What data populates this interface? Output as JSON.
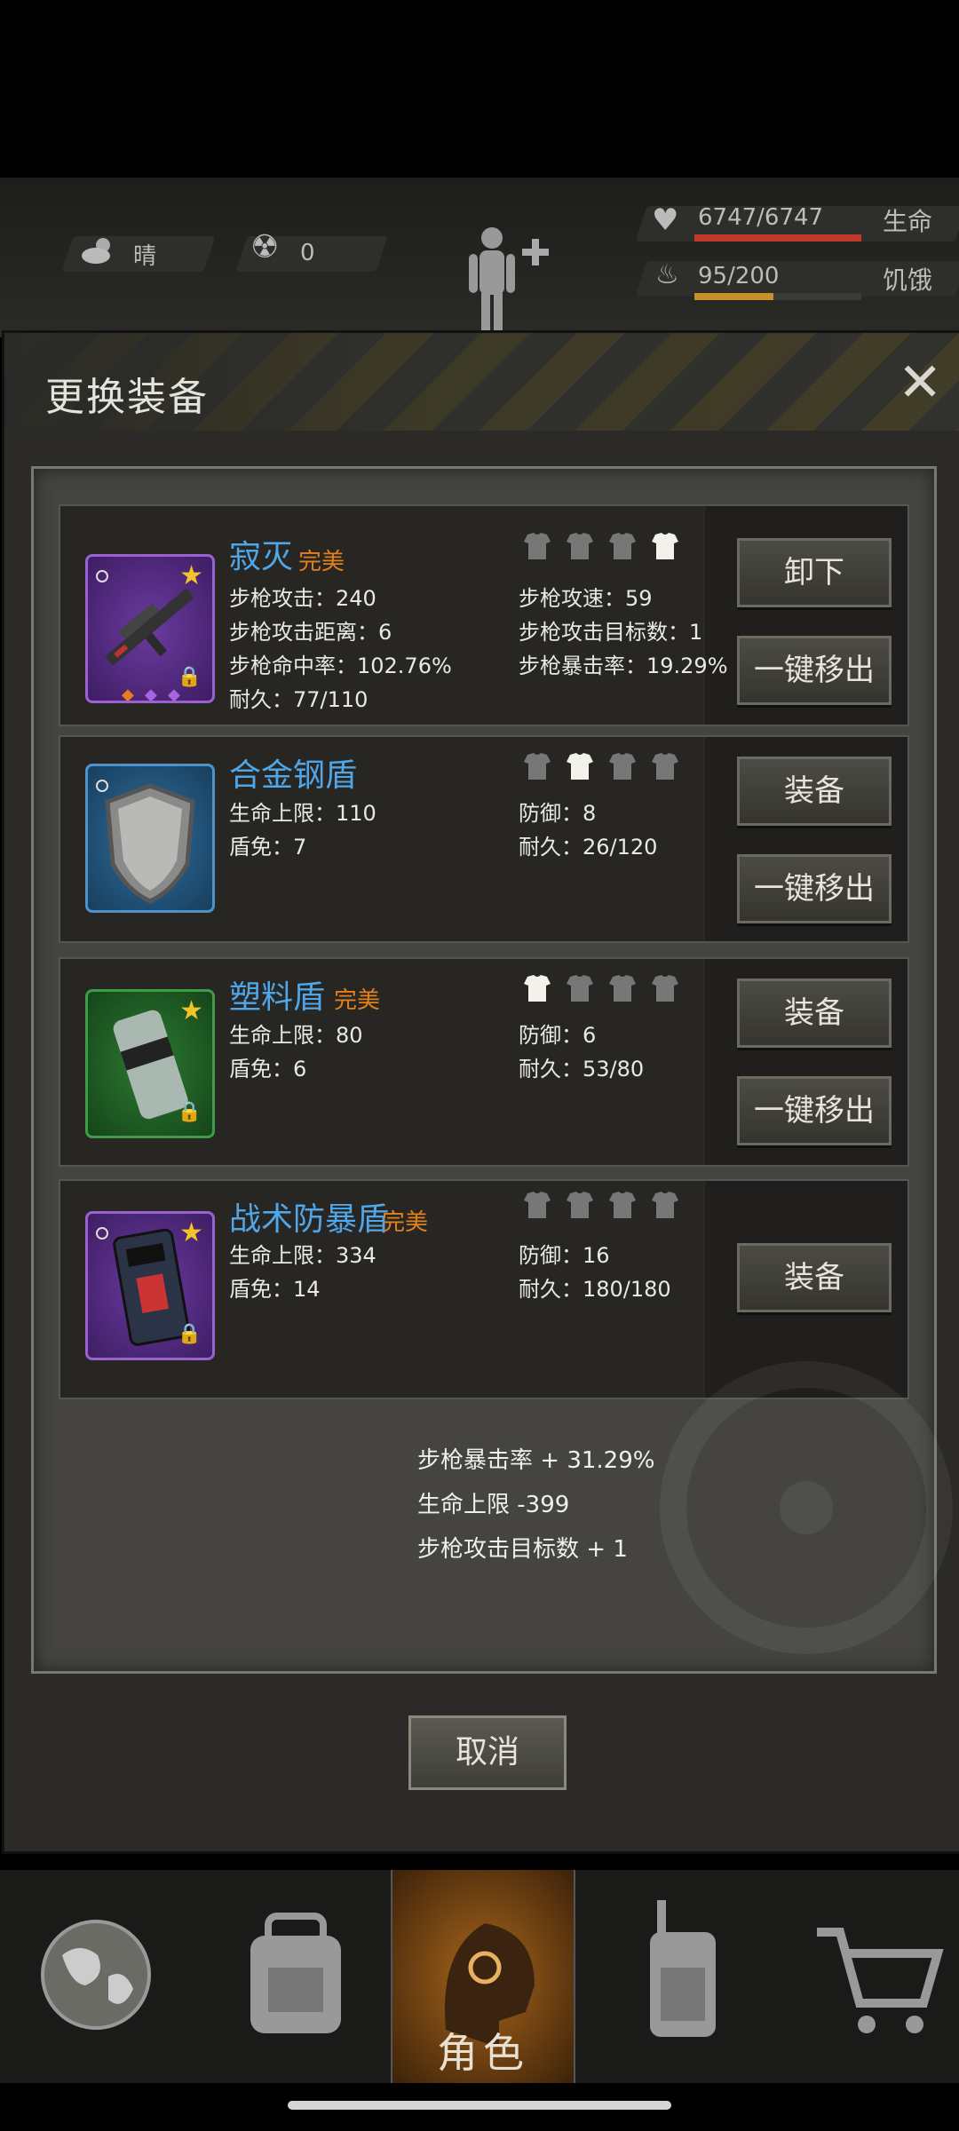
{
  "hud": {
    "weather": "晴",
    "radiation": "0",
    "life_value": "6747/6747",
    "life_label": "生命",
    "life_pct": 1.0,
    "hunger_value": "95/200",
    "hunger_label": "饥饿",
    "hunger_pct": 0.475
  },
  "modal": {
    "title": "更换装备",
    "cancel_label": "取消"
  },
  "items": [
    {
      "name": "寂灭",
      "quality": "完美",
      "stats_left": [
        "步枪攻击：240",
        "步枪攻击距离：6",
        "步枪命中率：102.76%",
        "耐久：77/110"
      ],
      "stats_right": [
        "步枪攻速：59",
        "步枪攻击目标数：1",
        "步枪暴击率：19.29%"
      ],
      "buttons": [
        "卸下",
        "一键移出"
      ],
      "icon": "rifle-icon",
      "starred": true,
      "locked": true
    },
    {
      "name": "合金钢盾",
      "quality": "",
      "stats_left": [
        "生命上限：110",
        "盾免：7"
      ],
      "stats_right": [
        "防御：8",
        "耐久：26/120"
      ],
      "buttons": [
        "装备",
        "一键移出"
      ],
      "icon": "steel-shield-icon",
      "starred": false,
      "locked": false
    },
    {
      "name": "塑料盾",
      "quality": "完美",
      "stats_left": [
        "生命上限：80",
        "盾免：6"
      ],
      "stats_right": [
        "防御：6",
        "耐久：53/80"
      ],
      "buttons": [
        "装备",
        "一键移出"
      ],
      "icon": "plastic-shield-icon",
      "starred": true,
      "locked": true
    },
    {
      "name": "战术防暴盾",
      "quality": "完美",
      "stats_left": [
        "生命上限：334",
        "盾免：14"
      ],
      "stats_right": [
        "防御：16",
        "耐久：180/180"
      ],
      "bonuses": [
        "步枪暴击率 + 31.29%",
        "生命上限 -399",
        "步枪攻击目标数 + 1"
      ],
      "buttons": [
        "装备"
      ],
      "icon": "riot-shield-icon",
      "starred": true,
      "locked": true
    }
  ],
  "nav": {
    "active_label": "角色",
    "tabs": [
      "globe-icon",
      "backpack-icon",
      "character-icon",
      "radio-icon",
      "cart-icon"
    ]
  },
  "colors": {
    "item_name": "#4fa6e8",
    "perfect": "#e3801e",
    "life_bar": "#c0392b",
    "hunger_bar": "#c8902a"
  }
}
